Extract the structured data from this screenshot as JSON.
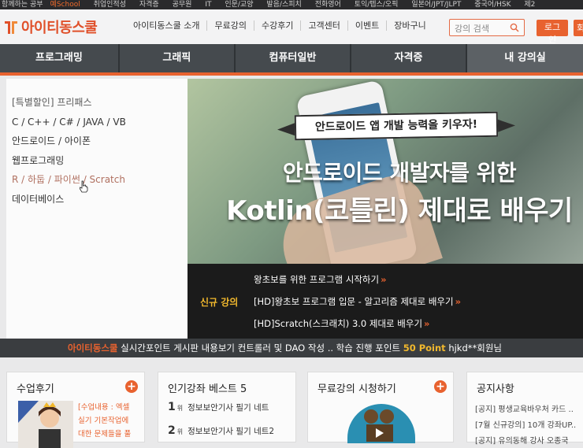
{
  "topstrip": {
    "items": [
      "함께하는 공부",
      "취업인적성",
      "자격증",
      "공무원",
      "IT",
      "인문/교양",
      "발음/스피치",
      "전화영어",
      "토익/텝스/오픽",
      "일본어/JPT/JLPT",
      "중국어/HSK",
      "제2"
    ],
    "highlight": "예School"
  },
  "header": {
    "logo_text": "아이티동스쿨",
    "gnb": [
      "아이티동스쿨 소개",
      "무료강의",
      "수강후기",
      "고객센터",
      "이벤트",
      "장바구니"
    ],
    "search_placeholder": "강의 검색",
    "login_label": "로그인",
    "extra_label": "회"
  },
  "mainnav": {
    "tabs": [
      "프로그래밍",
      "그래픽",
      "컴퓨터일반",
      "자격증",
      "내 강의실"
    ]
  },
  "leftmenu": {
    "items": [
      "[특별할인] 프리패스",
      "C / C++ / C# / JAVA / VB",
      "안드로이드 / 아이폰",
      "웹프로그래밍",
      "R / 하둡 / 파이썬 / Scratch",
      "데이터베이스"
    ]
  },
  "banner": {
    "subtitle": "안드로이드 앱 개발 능력을 키우자!",
    "headline1": "안드로이드 개발자를 위한",
    "headline2": "Kotlin(코틀린) 제대로 배우기"
  },
  "newcourses": {
    "label": "신규 강의",
    "items": [
      "왕초보를 위한 프로그램 시작하기",
      "[HD]왕초보 프로그램 입문 - 알고리즘 제대로 배우기",
      "[HD]Scratch(스크래치) 3.0 제대로 배우기"
    ],
    "arrow": "»"
  },
  "ticker": {
    "brand": "아이티동스쿨",
    "text": " 실시간포인트 게시판 내용보기 컨트롤러 및 DAO 작성 .. 학습 진행 포인트 ",
    "points": "50 Point",
    "user": " hjkd**회원님"
  },
  "boxes": {
    "review": {
      "title": "수업후기",
      "lines": [
        "[수업내용 : 엑셀",
        "실기 기본작업에",
        "대한 문제들을 풀"
      ]
    },
    "popular": {
      "title": "인기강좌 베스트 5",
      "ranks": [
        {
          "n": "1",
          "w": "위",
          "text": "정보보안기사 필기 네트"
        },
        {
          "n": "2",
          "w": "위",
          "text": "정보보안기사 필기 네트2"
        }
      ]
    },
    "free": {
      "title": "무료강의 시청하기"
    },
    "notice": {
      "title": "공지사항",
      "items": [
        "[공지] 평생교육바우처 카드 ..",
        "[7월 신규강의] 10개 강좌UP..",
        "[공지] 유의동해 강사 오종국"
      ]
    }
  },
  "colors": {
    "accent": "#e8622f",
    "nav_bg": "#454a4e",
    "yellow": "#f1b82d"
  }
}
